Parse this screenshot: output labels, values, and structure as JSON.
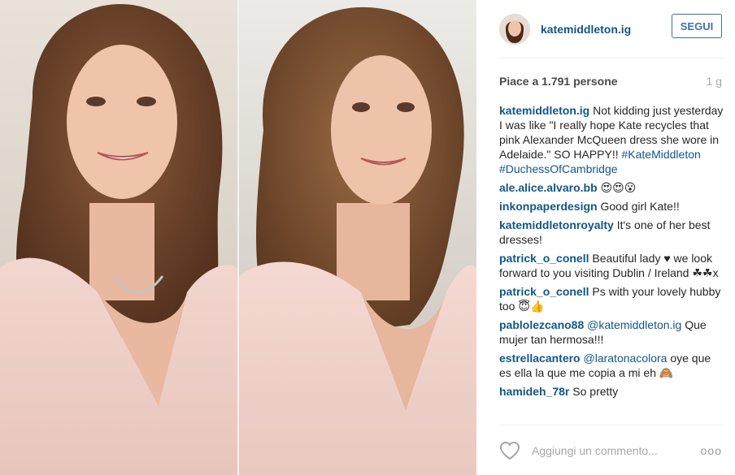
{
  "post": {
    "username": "katemiddleton.ig",
    "follow_label": "SEGUI",
    "likes_text": "Piace a 1.791 persone",
    "time_ago": "1 g",
    "comment_placeholder": "Aggiungi un commento...",
    "more_label": "ooo"
  },
  "comments": [
    {
      "user": "katemiddleton.ig",
      "text": " Not kidding just yesterday I was like \"I really hope Kate recycles that pink Alexander McQueen dress she wore in Adelaide.\" SO HAPPY!! ",
      "tags": "#KateMiddleton #DuchessOfCambridge"
    },
    {
      "user": "ale.alice.alvaro.bb",
      "text": " 😍😍😮"
    },
    {
      "user": "inkonpaperdesign",
      "text": " Good girl Kate!!"
    },
    {
      "user": "katemiddletonroyalty",
      "text": " It's one of her best dresses!"
    },
    {
      "user": "patrick_o_conell",
      "text": " Beautiful lady ♥ we look forward to you visiting Dublin / Ireland ☘☘x"
    },
    {
      "user": "patrick_o_conell",
      "text": " Ps with your lovely hubby too 😇👍"
    },
    {
      "user": "pablolezcano88",
      "mention": " @katemiddleton.ig",
      "text": " Que mujer tan hermosa!!!"
    },
    {
      "user": "estrellacantero",
      "mention": " @laratonacolora",
      "text": " oye que es ella la que me copia a mi eh 🙈"
    },
    {
      "user": "hamideh_78r",
      "text": " So pretty"
    }
  ],
  "colors": {
    "link": "#125688",
    "follow_border": "#3f729b",
    "muted": "#a5a7aa"
  },
  "icons": {
    "like": "heart-outline-icon",
    "more": "more-options-icon"
  }
}
